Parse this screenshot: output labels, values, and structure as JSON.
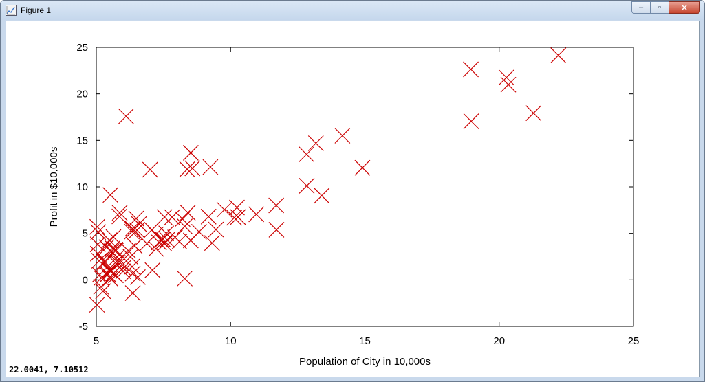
{
  "window": {
    "title": "Figure 1"
  },
  "controls": {
    "minimize": "–",
    "restore": "▫",
    "close": "✕"
  },
  "status": {
    "coords": "22.0041,  7.10512"
  },
  "chart_data": {
    "type": "scatter",
    "xlabel": "Population of City in 10,000s",
    "ylabel": "Profit in $10,000s",
    "xlim": [
      5,
      25
    ],
    "ylim": [
      -5,
      25
    ],
    "xticks": [
      5,
      10,
      15,
      20,
      25
    ],
    "yticks": [
      -5,
      0,
      5,
      10,
      15,
      20,
      25
    ],
    "marker": "x",
    "color": "#cc0000",
    "grid": false,
    "x": [
      6.1101,
      5.5277,
      8.5186,
      7.0032,
      5.8598,
      8.3829,
      7.4764,
      8.5781,
      6.4862,
      5.0546,
      5.7107,
      14.164,
      5.734,
      8.4084,
      5.6407,
      5.3794,
      6.3654,
      5.1301,
      6.4296,
      7.0708,
      6.1891,
      20.27,
      5.4901,
      6.3261,
      5.5649,
      18.945,
      12.828,
      10.957,
      13.176,
      22.203,
      5.2524,
      6.5894,
      9.2482,
      5.8918,
      8.2111,
      7.9334,
      8.0959,
      5.6063,
      12.836,
      6.3534,
      5.4069,
      6.8825,
      11.708,
      5.7737,
      7.8247,
      7.0931,
      5.0702,
      5.8014,
      11.7,
      5.5416,
      7.5402,
      5.3077,
      7.4239,
      7.6031,
      6.3328,
      6.3589,
      6.2742,
      5.6397,
      9.3102,
      9.4536,
      8.8254,
      5.1793,
      21.279,
      14.908,
      18.959,
      7.2182,
      8.2951,
      10.236,
      5.4994,
      20.341,
      10.136,
      7.3345,
      6.0062,
      7.2259,
      5.0269,
      6.5479,
      7.5386,
      5.0365,
      10.274,
      5.1077,
      5.7292,
      5.1884,
      6.3557,
      9.7687,
      6.5159,
      8.5172,
      9.1802,
      6.002,
      5.5204,
      5.0594,
      5.7077,
      7.6366,
      5.8707,
      5.3054,
      8.2934,
      13.394,
      5.4369
    ],
    "y": [
      17.592,
      9.1302,
      13.662,
      11.854,
      6.8233,
      11.886,
      4.3483,
      12,
      6.5987,
      3.8166,
      3.2522,
      15.505,
      3.1551,
      7.2258,
      0.71618,
      3.5129,
      5.3048,
      0.56077,
      3.6518,
      5.3893,
      3.1386,
      21.767,
      4.263,
      5.1875,
      3.0825,
      22.638,
      13.501,
      7.0467,
      14.692,
      24.147,
      -1.22,
      5.9966,
      12.134,
      1.8495,
      6.5426,
      4.5623,
      4.1164,
      3.3928,
      10.117,
      5.4974,
      0.55657,
      3.9115,
      5.3854,
      2.4406,
      6.7318,
      1.0463,
      5.1337,
      1.844,
      8.0043,
      1.0179,
      6.7504,
      1.8396,
      4.2885,
      4.9981,
      1.4233,
      -1.4211,
      2.4756,
      4.6042,
      3.9624,
      5.4141,
      5.1694,
      -0.74279,
      17.929,
      12.054,
      17.054,
      4.8852,
      5.7442,
      7.7754,
      1.0173,
      20.992,
      6.6799,
      4.0259,
      1.2784,
      3.3411,
      -2.6807,
      0.29678,
      3.8845,
      5.7014,
      6.7526,
      2.0576,
      0.47953,
      0.20421,
      0.67861,
      7.5435,
      5.3436,
      4.2415,
      6.7981,
      0.92695,
      0.152,
      2.8214,
      1.8451,
      4.2959,
      7.2029,
      1.9869,
      0.14454,
      9.0551,
      0.61705
    ]
  }
}
